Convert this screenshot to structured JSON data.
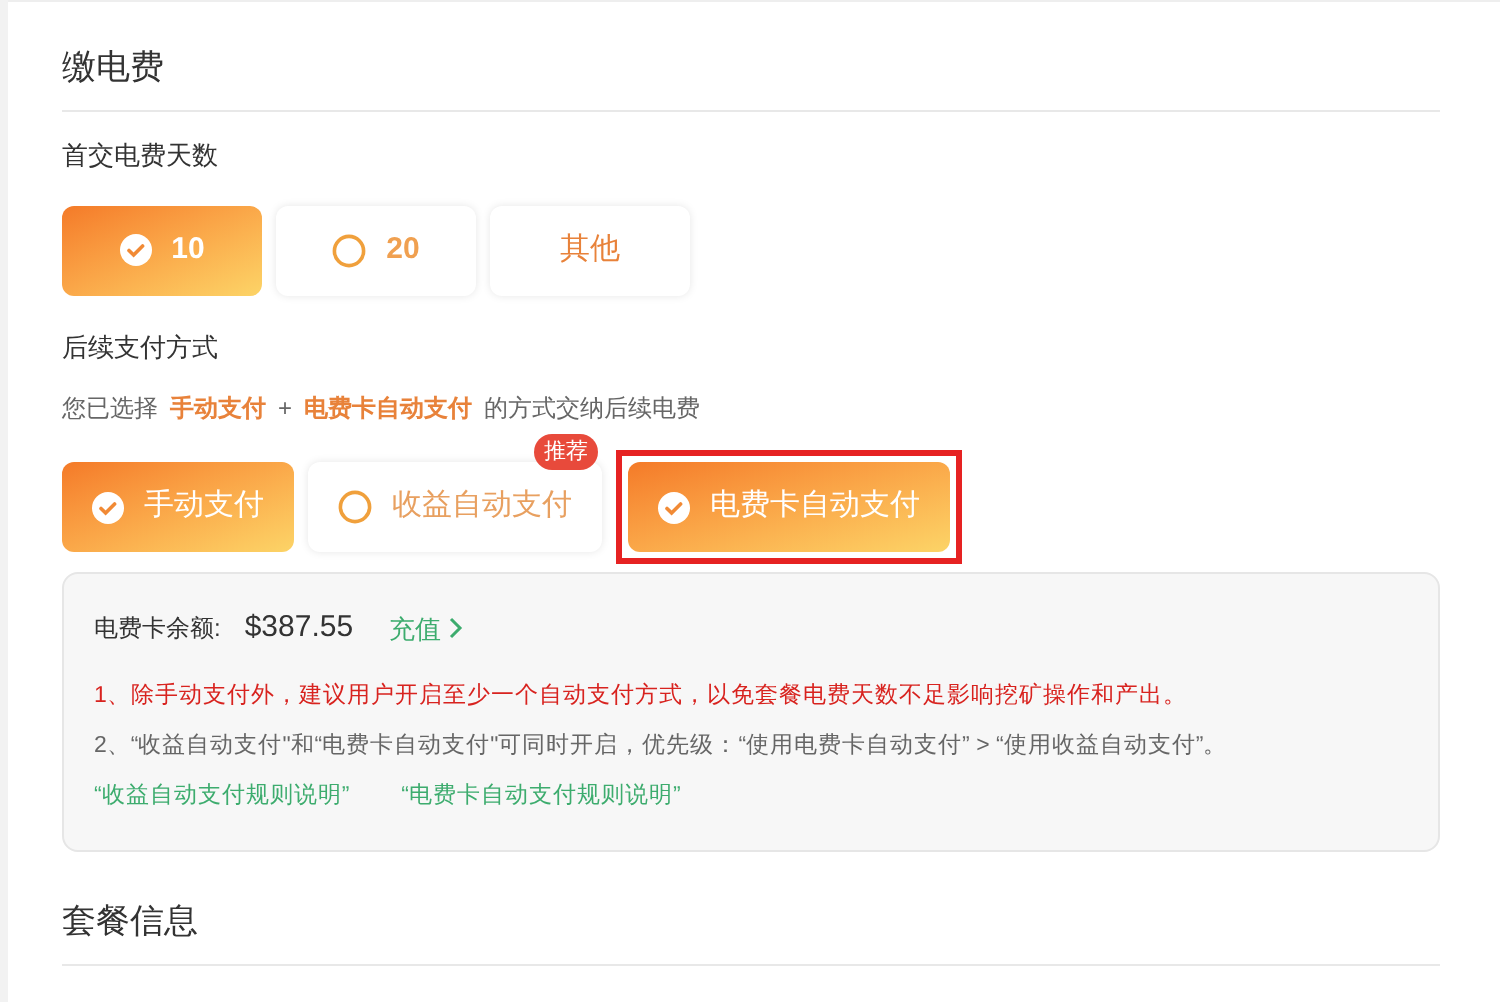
{
  "section_title": "缴电费",
  "days": {
    "label": "首交电费天数",
    "options": [
      {
        "label": "10",
        "kind": "radio",
        "selected": true
      },
      {
        "label": "20",
        "kind": "radio",
        "selected": false
      },
      {
        "label": "其他",
        "kind": "text",
        "selected": false
      }
    ]
  },
  "payment": {
    "label": "后续支付方式",
    "summary": [
      {
        "text": "您已选择",
        "kind": "plain"
      },
      {
        "text": "手动支付",
        "kind": "accent"
      },
      {
        "text": "+",
        "kind": "plain"
      },
      {
        "text": "电费卡自动支付",
        "kind": "accent"
      },
      {
        "text": "的方式交纳后续电费",
        "kind": "plain"
      }
    ],
    "options": [
      {
        "label": "手动支付",
        "selected": true,
        "highlighted": false
      },
      {
        "label": "收益自动支付",
        "selected": false,
        "highlighted": false,
        "badge": "推荐"
      },
      {
        "label": "电费卡自动支付",
        "selected": true,
        "highlighted": true
      }
    ]
  },
  "info": {
    "balance_label": "电费卡余额:",
    "balance": "$387.55",
    "recharge": "充值",
    "notes": [
      {
        "text": "1、除手动支付外，建议用户开启至少一个自动支付方式，以免套餐电费天数不足影响挖矿操作和产出。",
        "kind": "warning"
      },
      {
        "text": "2、“收益自动支付\"和“电费卡自动支付\"可同时开启，优先级：“使用电费卡自动支付” > “使用收益自动支付”。",
        "kind": "normal"
      }
    ],
    "links": [
      "“收益自动支付规则说明”",
      "“电费卡自动支付规则说明”"
    ]
  },
  "next_section_title": "套餐信息"
}
